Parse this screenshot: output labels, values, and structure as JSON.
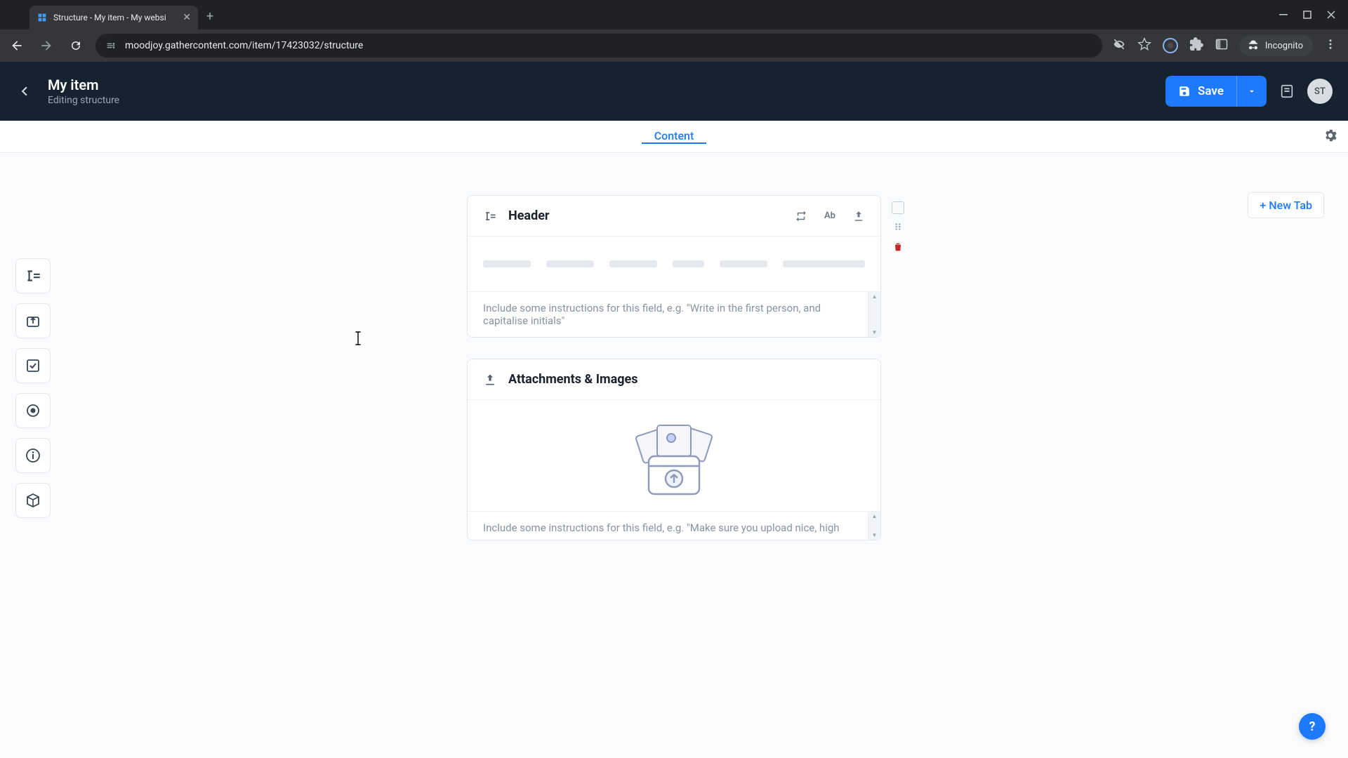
{
  "browser": {
    "tab_title": "Structure - My item - My websi",
    "url": "moodjoy.gathercontent.com/item/17423032/structure",
    "incognito_label": "Incognito"
  },
  "header": {
    "back_aria": "Back",
    "title": "My item",
    "subtitle": "Editing structure",
    "save_label": "Save",
    "avatar_initials": "ST"
  },
  "tabs": {
    "items": [
      {
        "label": "Content",
        "active": true
      }
    ],
    "new_tab_label": "+ New Tab"
  },
  "fields": [
    {
      "kind": "richtext",
      "name": "Header",
      "instructions_placeholder": "Include some instructions for this field, e.g. \"Write in the first person, and capitalise initials\"",
      "header_actions": [
        "repeat",
        "ab",
        "export"
      ]
    },
    {
      "kind": "attachment",
      "name": "Attachments & Images",
      "instructions_placeholder": "Include some instructions for this field, e.g. \"Make sure you upload nice, high"
    }
  ],
  "rail_tools": [
    "text-field",
    "attachment-field",
    "checkbox-field",
    "radio-field",
    "guideline-field",
    "component-field"
  ],
  "colors": {
    "accent": "#1d7afc",
    "header_bg": "#16232e",
    "danger": "#c62828"
  }
}
